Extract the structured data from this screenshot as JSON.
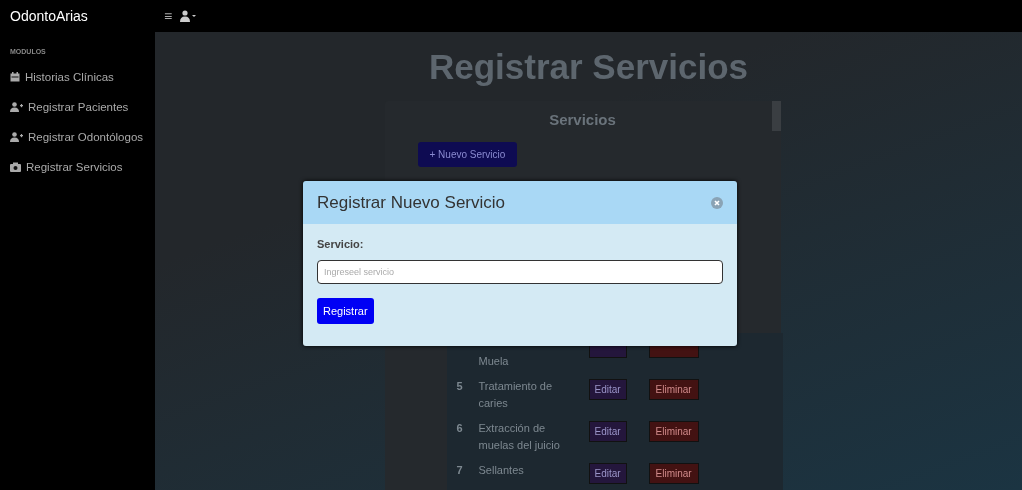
{
  "navbar": {
    "brand": "OdontoArias",
    "menu_icon": "≡"
  },
  "sidebar": {
    "heading": "MODULOS",
    "items": [
      {
        "label": "Historias Clínicas"
      },
      {
        "label": "Registrar Pacientes"
      },
      {
        "label": "Registrar Odontólogos"
      },
      {
        "label": "Registrar Servicios"
      }
    ]
  },
  "page": {
    "title": "Registrar Servicios",
    "card_title": "Servicios",
    "new_button": "+ Nuevo Servicio",
    "rows": [
      {
        "number": null,
        "name": [
          "Muela"
        ],
        "edit": null,
        "delete": null
      },
      {
        "number": "5",
        "name": [
          "Tratamiento de",
          "caries"
        ],
        "edit": "Editar",
        "delete": "Eliminar"
      },
      {
        "number": "6",
        "name": [
          "Extracción de",
          "muelas del juicio"
        ],
        "edit": "Editar",
        "delete": "Eliminar"
      },
      {
        "number": "7",
        "name": [
          "Sellantes"
        ],
        "edit": "Editar",
        "delete": "Eliminar"
      }
    ]
  },
  "modal": {
    "title": "Registrar Nuevo Servicio",
    "field_label": "Servicio:",
    "placeholder": "Ingreseel servicio",
    "submit": "Registrar"
  }
}
